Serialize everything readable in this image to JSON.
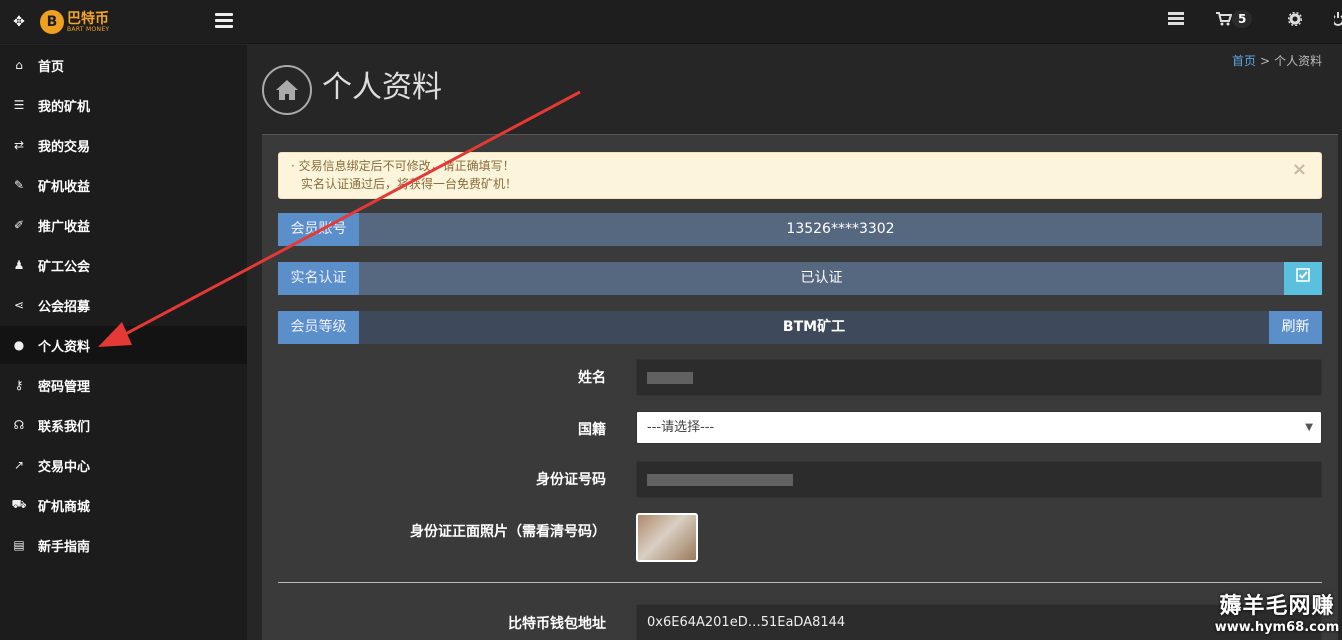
{
  "app": {
    "logo_name": "巴特币",
    "logo_sub": "BART MONEY",
    "logo_badge": "B"
  },
  "topbar": {
    "cart_count": "5"
  },
  "sidebar": {
    "items": [
      {
        "label": "首页",
        "icon": "home-icon"
      },
      {
        "label": "我的矿机",
        "icon": "server-icon"
      },
      {
        "label": "我的交易",
        "icon": "exchange-icon"
      },
      {
        "label": "矿机收益",
        "icon": "income-icon"
      },
      {
        "label": "推广收益",
        "icon": "magic-wand-icon"
      },
      {
        "label": "矿工公会",
        "icon": "users-icon"
      },
      {
        "label": "公会招募",
        "icon": "share-icon"
      },
      {
        "label": "个人资料",
        "icon": "user-icon",
        "active": true
      },
      {
        "label": "密码管理",
        "icon": "key-icon"
      },
      {
        "label": "联系我们",
        "icon": "headphones-icon"
      },
      {
        "label": "交易中心",
        "icon": "line-chart-icon"
      },
      {
        "label": "矿机商城",
        "icon": "cart-icon"
      },
      {
        "label": "新手指南",
        "icon": "book-icon"
      }
    ]
  },
  "breadcrumb": {
    "home": "首页",
    "separator": ">",
    "current": "个人资料"
  },
  "page": {
    "title": "个人资料"
  },
  "alert": {
    "line1": "· 交易信息绑定后不可修改，请正确填写！",
    "line2": "实名认证通过后，将获得一台免费矿机！",
    "close": "×"
  },
  "rows": {
    "account_label": "会员账号",
    "account_value": "13526****3302",
    "verify_label": "实名认证",
    "verify_value": "已认证",
    "level_label": "会员等级",
    "level_value": "BTM矿工",
    "refresh_label": "刷新"
  },
  "form": {
    "name_label": "姓名",
    "nation_label": "国籍",
    "nation_value": "---请选择---",
    "id_label": "身份证号码",
    "photo_label": "身份证正面照片（需看清号码）",
    "wallet_label": "比特币钱包地址",
    "wallet_value": "0x6E64A201eD…51EaDA8144"
  },
  "watermark": {
    "title": "薅羊毛网赚",
    "url": "www.hym68.com"
  },
  "colors": {
    "accent_blue": "#5b8fc9",
    "verify_btn": "#5bc0de",
    "alert_bg": "#fcf5dc",
    "arrow_red": "#e53935"
  }
}
